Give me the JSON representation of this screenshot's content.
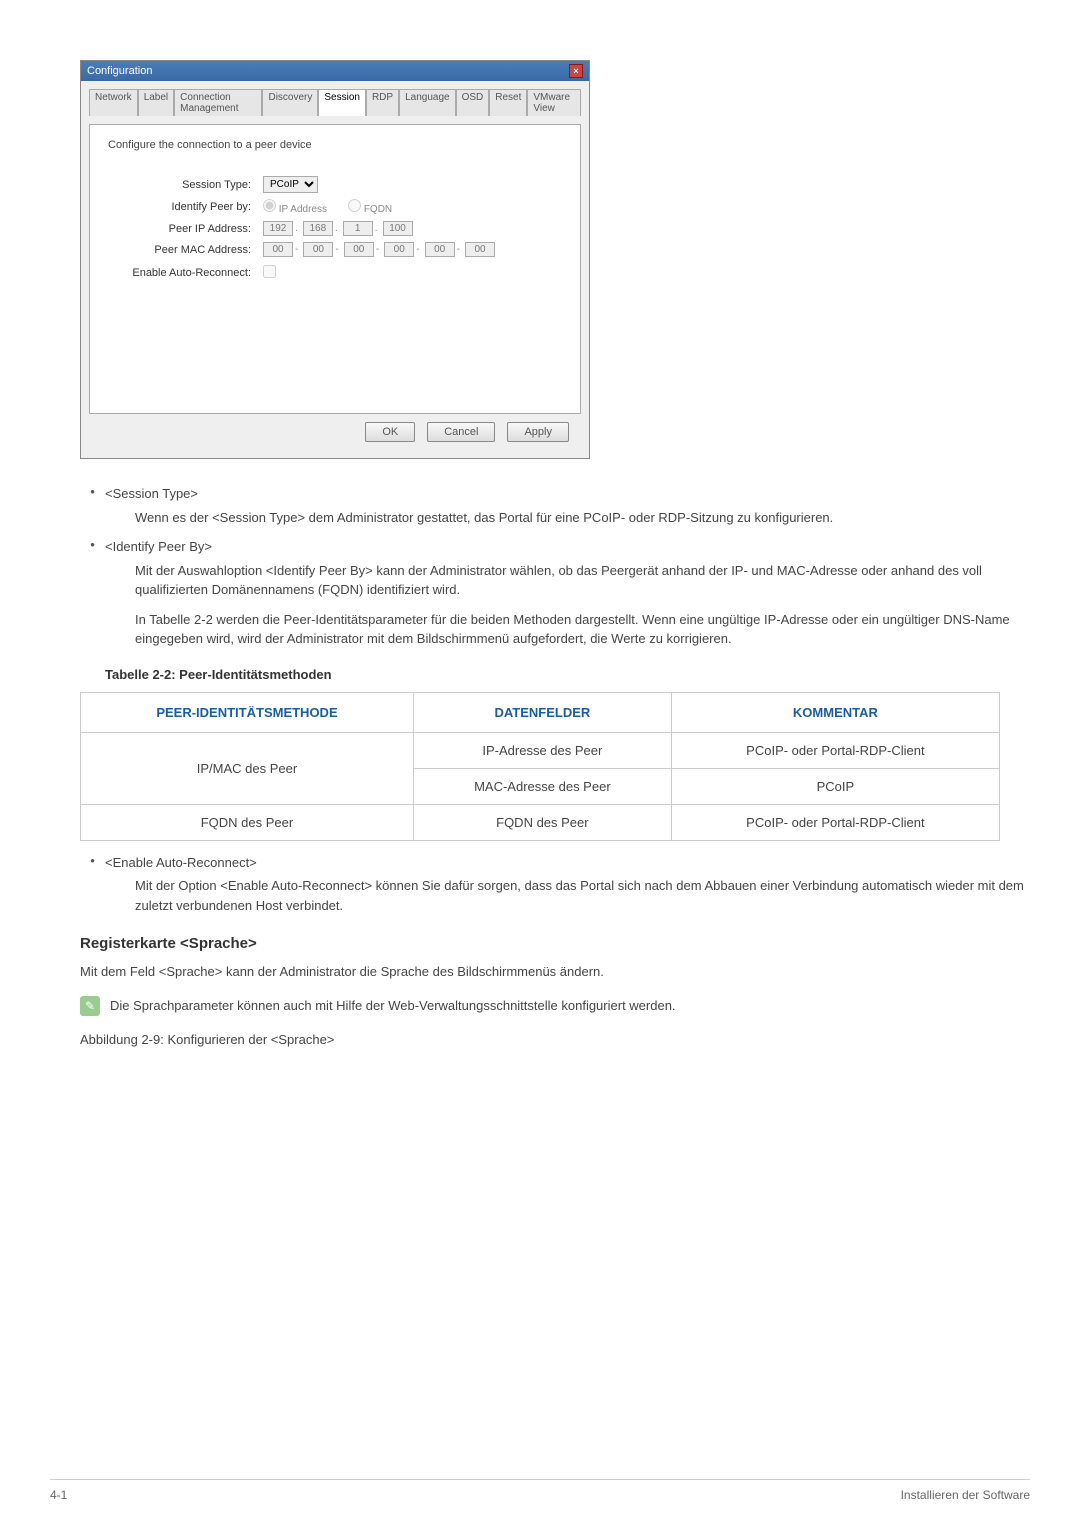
{
  "dialog": {
    "title": "Configuration",
    "close_glyph": "×",
    "tabs": [
      "Network",
      "Label",
      "Connection Management",
      "Discovery",
      "Session",
      "RDP",
      "Language",
      "OSD",
      "Reset",
      "VMware View"
    ],
    "active_tab_index": 4,
    "description": "Configure the connection to a peer device",
    "fields": {
      "session_type": {
        "label": "Session Type:",
        "value": "PCoIP"
      },
      "identify_peer": {
        "label": "Identify Peer by:",
        "opt1": "IP Address",
        "opt2": "FQDN"
      },
      "peer_ip": {
        "label": "Peer IP Address:",
        "o1": "192",
        "o2": "168",
        "o3": "1",
        "o4": "100"
      },
      "peer_mac": {
        "label": "Peer MAC Address:",
        "m1": "00",
        "m2": "00",
        "m3": "00",
        "m4": "00",
        "m5": "00",
        "m6": "00"
      },
      "auto_reconnect": {
        "label": "Enable Auto-Reconnect:"
      }
    },
    "buttons": {
      "ok": "OK",
      "cancel": "Cancel",
      "apply": "Apply"
    }
  },
  "list": {
    "item1_head": "<Session Type>",
    "item1_body": "Wenn es der <Session Type> dem Administrator gestattet, das Portal für eine PCoIP- oder RDP-Sitzung zu konfigurieren.",
    "item2_head": "<Identify Peer By>",
    "item2_body": "Mit der Auswahloption <Identify Peer By> kann der Administrator wählen, ob das Peergerät anhand der IP- und MAC-Adresse oder anhand des voll qualifizierten Domänennamens (FQDN) identifiziert wird.",
    "item2_body2": "In Tabelle 2-2 werden die Peer-Identitätsparameter für die beiden Methoden dargestellt. Wenn eine ungültige IP-Adresse oder ein ungültiger DNS-Name eingegeben wird, wird der Administrator mit dem Bildschirmmenü aufgefordert, die Werte zu korrigieren.",
    "item3_head": "<Enable Auto-Reconnect>",
    "item3_body": "Mit der Option <Enable Auto-Reconnect> können Sie dafür sorgen, dass das Portal sich nach dem Abbauen einer Verbindung automatisch wieder mit dem zuletzt verbundenen Host verbindet."
  },
  "table": {
    "title": "Tabelle 2-2: Peer-Identitätsmethoden",
    "headers": {
      "c1": "PEER-IDENTITÄTSMETHODE",
      "c2": "DATENFELDER",
      "c3": "KOMMENTAR"
    },
    "rows": [
      {
        "c1": "IP/MAC des Peer",
        "c2": "IP-Adresse des Peer",
        "c3": "PCoIP- oder Portal-RDP-Client"
      },
      {
        "c1": "",
        "c2": "MAC-Adresse des Peer",
        "c3": "PCoIP"
      },
      {
        "c1": "FQDN des Peer",
        "c2": "FQDN des Peer",
        "c3": "PCoIP- oder Portal-RDP-Client"
      }
    ]
  },
  "section_lang": {
    "heading": "Registerkarte <Sprache>",
    "p1": "Mit dem Feld <Sprache> kann der Administrator die Sprache des Bildschirmmenüs ändern.",
    "note_glyph": "✎",
    "note": "Die Sprachparameter können auch mit Hilfe der Web-Verwaltungsschnittstelle konfiguriert werden.",
    "fig_caption": "Abbildung 2-9: Konfigurieren der <Sprache>"
  },
  "footer": {
    "left": "4-1",
    "right": "Installieren der Software"
  }
}
